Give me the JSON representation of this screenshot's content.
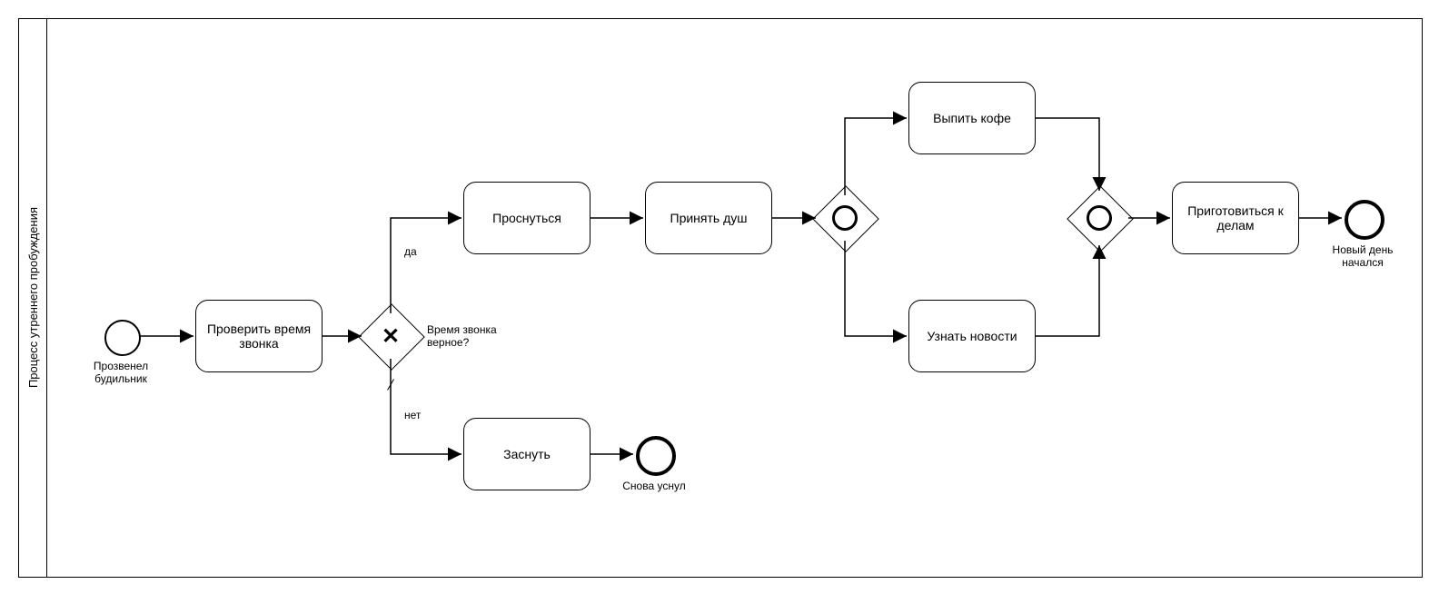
{
  "pool": {
    "title": "Процесс утреннего пробуждения"
  },
  "events": {
    "start": {
      "label": "Прозвенел будильник"
    },
    "end_sleep": {
      "label": "Снова уснул"
    },
    "end_day": {
      "label": "Новый день начался"
    }
  },
  "tasks": {
    "check_time": "Проверить время звонка",
    "wake_up": "Проснуться",
    "shower": "Принять душ",
    "sleep": "Заснуть",
    "coffee": "Выпить кофе",
    "news": "Узнать новости",
    "prepare": "Приготовиться к делам"
  },
  "gateways": {
    "decision": {
      "label": "Время звонка верное?"
    },
    "edge_yes": "да",
    "edge_no": "нет"
  }
}
